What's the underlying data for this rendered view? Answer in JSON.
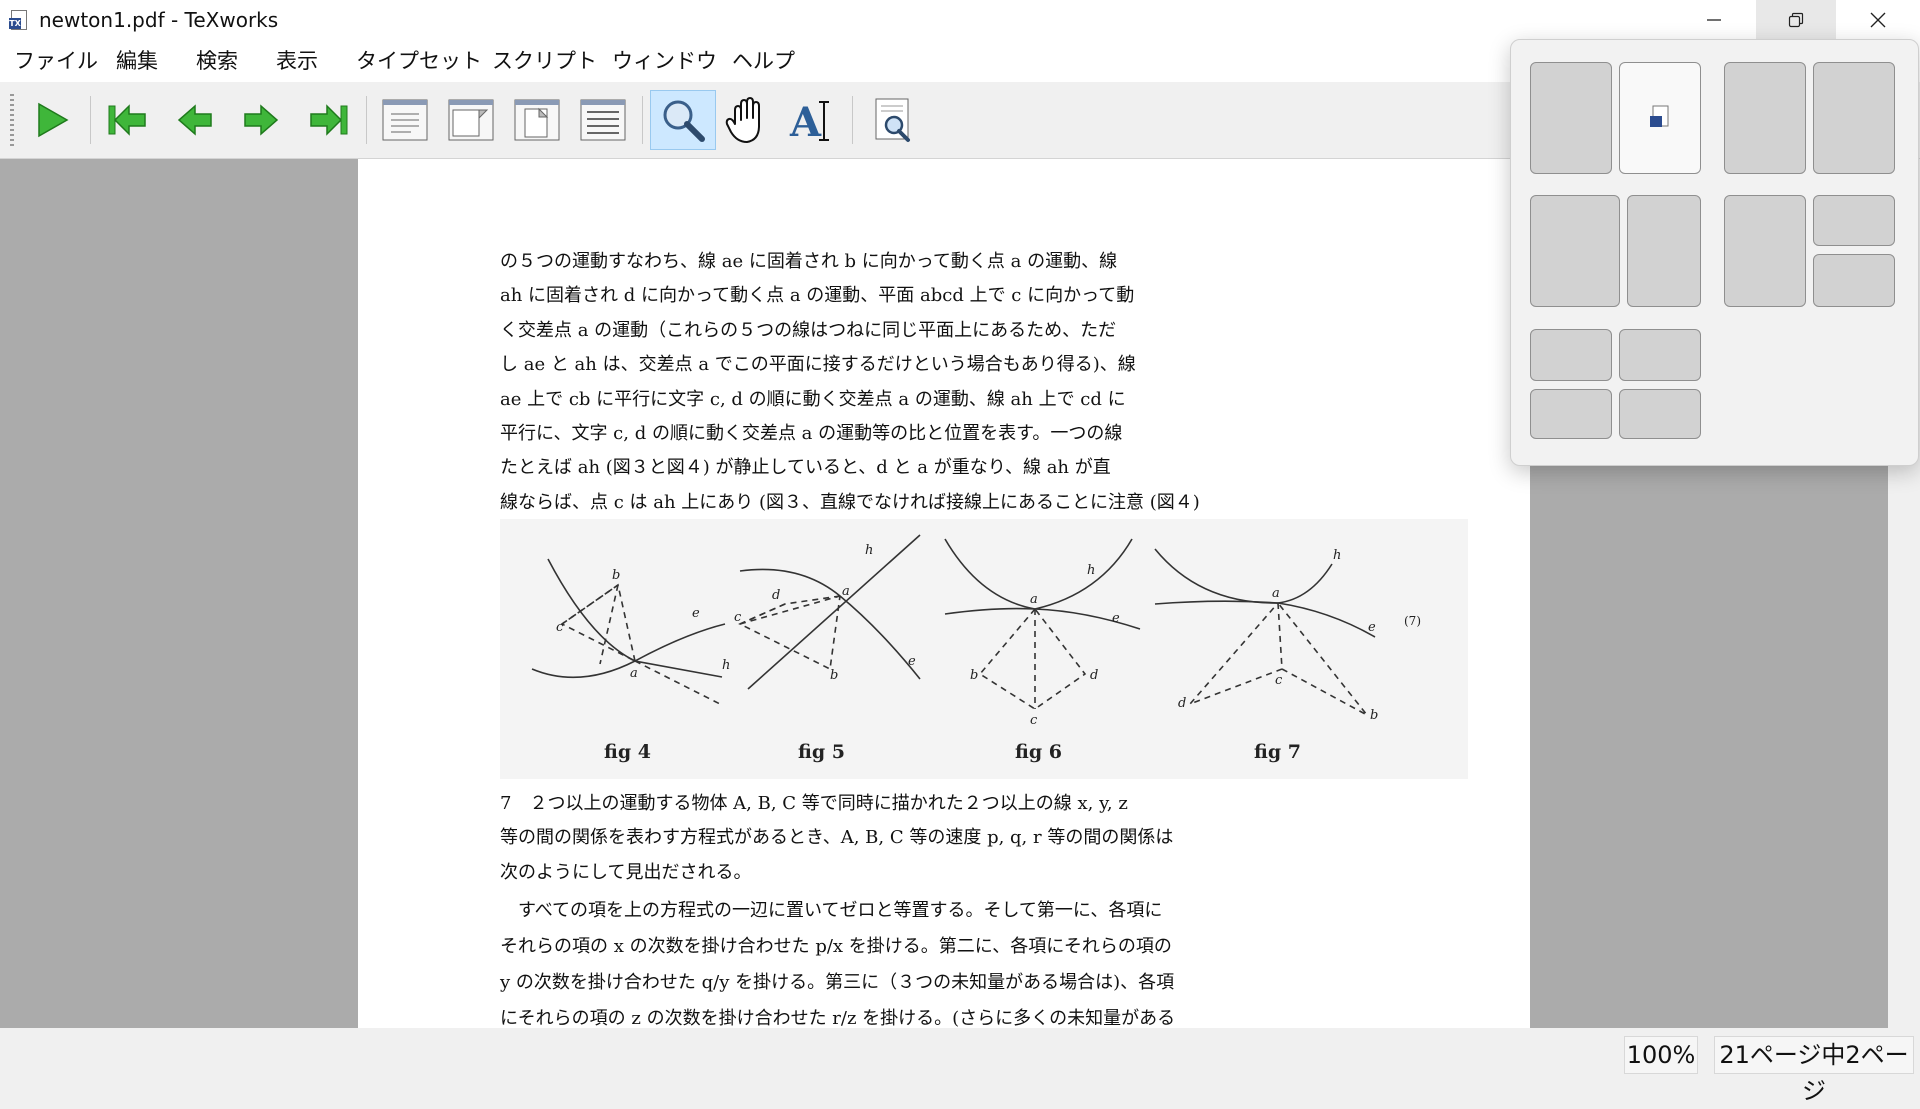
{
  "window": {
    "title": "newton1.pdf - TeXworks",
    "icon": "texworks-app-icon",
    "app_icon_letters": "TX"
  },
  "menu": [
    "ファイル",
    "編集",
    "検索",
    "表示",
    "タイプセット",
    "スクリプト",
    "ウィンドウ",
    "ヘルプ"
  ],
  "toolbar": {
    "buttons": [
      "typeset-run-icon",
      "first-page-icon",
      "previous-page-icon",
      "next-page-icon",
      "last-page-icon",
      "actual-size-icon",
      "fit-width-icon",
      "fit-page-icon",
      "fit-content-icon",
      "magnify-tool-icon",
      "scroll-hand-icon",
      "select-text-icon",
      "find-icon"
    ],
    "active_tool": "magnify-tool-icon"
  },
  "document": {
    "para1": [
      "の５つの運動すなわち、線 ae に固着され b に向かって動く点 a の運動、線",
      "ah に固着され d に向かって動く点 a の運動、平面 abcd 上で c に向かって動",
      "く交差点 a の運動（これらの５つの線はつねに同じ平面上にあるため、ただ",
      "し ae と ah は、交差点 a でこの平面に接するだけという場合もあり得る)、線",
      "ae 上で cb に平行に文字 c, d の順に動く交差点 a の運動、線 ah 上で cd に",
      "平行に、文字 c, d の順に動く交差点 a の運動等の比と位置を表す。一つの線",
      "たとえば ah (図３と図４) が静止していると、d と a が重なり、線 ah が直",
      "線ならば、点 c は ah 上にあり (図３、直線でなければ接線上にあることに注意 (図４)"
    ],
    "figure_labels": [
      "fig 4",
      "fig 5",
      "fig 6",
      "fig 7"
    ],
    "figure_number": "(7)",
    "section_para": [
      "7　２つ以上の運動する物体 A, B, C 等で同時に描かれた２つ以上の線 x, y, z",
      "等の間の関係を表わす方程式があるとき、A, B, C 等の速度 p, q, r 等の間の関係は",
      "次のようにして見出だされる。"
    ],
    "para3": [
      "　すべての項を上の方程式の一辺に置いてゼロと等置する。そして第一に、各項に",
      "それらの項の x の次数を掛け合わせた p/x を掛ける。第二に、各項にそれらの項の",
      "y の次数を掛け合わせた q/y を掛ける。第三に（３つの未知量がある場合は)、各項",
      "にそれらの項の z の次数を掛け合わせた r/z を掛ける。(さらに多くの未知量がある"
    ]
  },
  "statusbar": {
    "zoom": "100%",
    "page_info": "21ページ中2ページ"
  },
  "window_controls": [
    "minimize-icon",
    "restore-icon",
    "close-icon"
  ],
  "snap_layouts": {
    "visible": true,
    "layouts": [
      "two-equal-columns",
      "two-equal-columns-wide",
      "two-columns-left-wide",
      "column-and-stacked-pair",
      "four-quadrants"
    ],
    "highlighted_zone": "two-equal-columns-right"
  }
}
